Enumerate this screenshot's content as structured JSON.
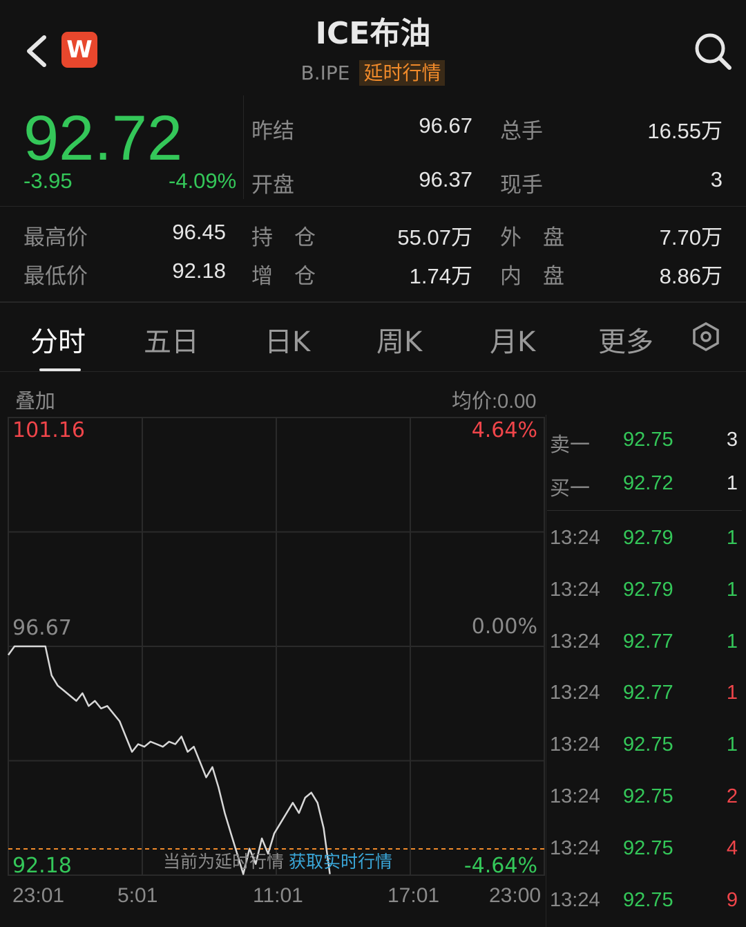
{
  "header": {
    "title": "ICE布油",
    "code": "B.IPE",
    "badge": "延时行情",
    "logo_text": "W",
    "back_icon": "chevron-left-icon",
    "search_icon": "search-icon"
  },
  "quote": {
    "price": "92.72",
    "change": "-3.95",
    "change_pct": "-4.09%",
    "stats_top": [
      {
        "label": "昨结",
        "value": "96.67"
      },
      {
        "label": "总手",
        "value": "16.55万"
      },
      {
        "label": "开盘",
        "value": "96.37"
      },
      {
        "label": "现手",
        "value": "3"
      }
    ],
    "stats_bottom": [
      {
        "label": "最高价",
        "value": "96.45"
      },
      {
        "label": "持　仓",
        "value": "55.07万"
      },
      {
        "label": "外　盘",
        "value": "7.70万"
      },
      {
        "label": "最低价",
        "value": "92.18"
      },
      {
        "label": "增　仓",
        "value": "1.74万"
      },
      {
        "label": "内　盘",
        "value": "8.86万"
      }
    ]
  },
  "tabs": [
    "分时",
    "五日",
    "日K",
    "周K",
    "月K",
    "更多"
  ],
  "chart_toolbar": {
    "overlay": "叠加",
    "avg": "均价:0.00"
  },
  "chart_data": {
    "type": "line",
    "y_top_label": "101.16",
    "y_mid_label": "96.67",
    "y_bottom_label": "92.18",
    "pct_top": "4.64%",
    "pct_mid": "0.00%",
    "pct_bottom": "-4.64%",
    "x_ticks": [
      "23:01",
      "5:01",
      "11:01",
      "17:01",
      "23:00"
    ],
    "ylim": [
      92.18,
      101.16
    ],
    "prev_close": 96.67,
    "series": [
      {
        "values": [
          96.5,
          96.67,
          96.67,
          96.67,
          96.67,
          96.67,
          96.67,
          96.1,
          95.9,
          95.8,
          95.7,
          95.6,
          95.75,
          95.5,
          95.6,
          95.45,
          95.5,
          95.35,
          95.2,
          94.9,
          94.6,
          94.75,
          94.7,
          94.8,
          94.75,
          94.7,
          94.8,
          94.75,
          94.9,
          94.6,
          94.7,
          94.4,
          94.1,
          94.3,
          93.9,
          93.4,
          93.0,
          92.6,
          92.2,
          92.7,
          92.4,
          92.9,
          92.6,
          93.0,
          93.2,
          93.4,
          93.6,
          93.4,
          93.7,
          93.8,
          93.6,
          93.1,
          92.2
        ]
      }
    ],
    "delay_notice": "当前为延时行情",
    "delay_link": "获取实时行情"
  },
  "order_book": [
    {
      "label": "卖一",
      "price": "92.75",
      "vol": "3",
      "vol_color": "white"
    },
    {
      "label": "买一",
      "price": "92.72",
      "vol": "1",
      "vol_color": "white"
    }
  ],
  "ticks": [
    {
      "time": "13:24",
      "price": "92.79",
      "vol": "1",
      "vol_color": "green"
    },
    {
      "time": "13:24",
      "price": "92.79",
      "vol": "1",
      "vol_color": "green"
    },
    {
      "time": "13:24",
      "price": "92.77",
      "vol": "1",
      "vol_color": "green"
    },
    {
      "time": "13:24",
      "price": "92.77",
      "vol": "1",
      "vol_color": "red"
    },
    {
      "time": "13:24",
      "price": "92.75",
      "vol": "1",
      "vol_color": "green"
    },
    {
      "time": "13:24",
      "price": "92.75",
      "vol": "2",
      "vol_color": "red"
    },
    {
      "time": "13:24",
      "price": "92.75",
      "vol": "4",
      "vol_color": "red"
    },
    {
      "time": "13:24",
      "price": "92.75",
      "vol": "9",
      "vol_color": "red"
    }
  ],
  "colors": {
    "up": "#f0454a",
    "down": "#34c759",
    "accent": "#f08a2a",
    "link": "#3aa6d8"
  }
}
